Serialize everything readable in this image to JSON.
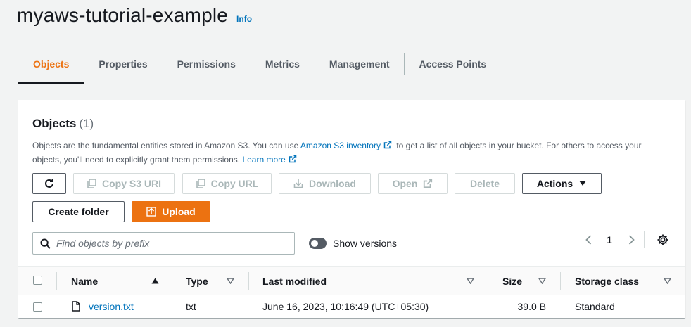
{
  "header": {
    "bucket_name": "myaws-tutorial-example",
    "info_label": "Info"
  },
  "tabs": [
    {
      "label": "Objects",
      "active": true
    },
    {
      "label": "Properties"
    },
    {
      "label": "Permissions"
    },
    {
      "label": "Metrics"
    },
    {
      "label": "Management"
    },
    {
      "label": "Access Points"
    }
  ],
  "objects_panel": {
    "title": "Objects",
    "count": "(1)",
    "description_part1": "Objects are the fundamental entities stored in Amazon S3. You can use ",
    "inventory_link": "Amazon S3 inventory",
    "description_part2": " to get a list of all objects in your bucket. For others to access your objects, you'll need to explicitly grant them permissions.",
    "learn_more": "Learn more"
  },
  "toolbar": {
    "copy_s3_uri": "Copy S3 URI",
    "copy_url": "Copy URL",
    "download": "Download",
    "open": "Open",
    "delete": "Delete",
    "actions": "Actions",
    "create_folder": "Create folder",
    "upload": "Upload"
  },
  "search": {
    "placeholder": "Find objects by prefix"
  },
  "versions_toggle": {
    "label": "Show versions",
    "on": false
  },
  "pagination": {
    "current_page": "1"
  },
  "table": {
    "columns": [
      "Name",
      "Type",
      "Last modified",
      "Size",
      "Storage class"
    ],
    "rows": [
      {
        "name": "version.txt",
        "type": "txt",
        "last_modified": "June 16, 2023, 10:16:49 (UTC+05:30)",
        "size": "39.0 B",
        "storage_class": "Standard"
      }
    ]
  },
  "colors": {
    "accent": "#ec7211",
    "link": "#0073bb",
    "text": "#16191f",
    "muted": "#545b64"
  }
}
